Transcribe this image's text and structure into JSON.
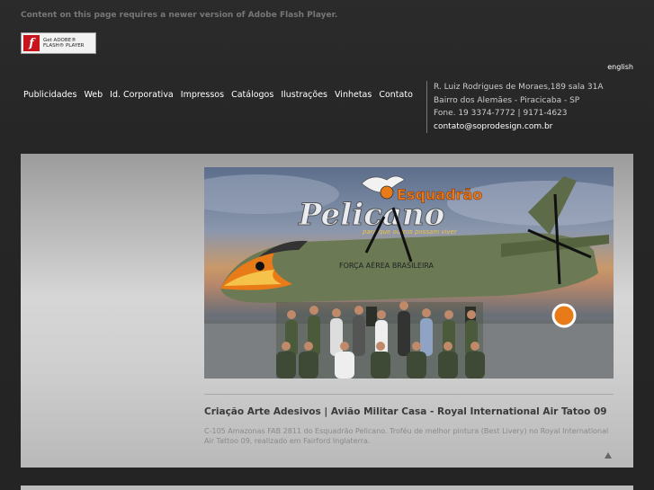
{
  "flash": {
    "message": "Content on this page requires a newer version of Adobe Flash Player.",
    "badge_top": "Get ADOBE®",
    "badge_bottom": "FLASH® PLAYER",
    "icon_letter": "f"
  },
  "lang_link": "english",
  "menu": {
    "items": [
      {
        "label": "Publicidades"
      },
      {
        "label": "Web"
      },
      {
        "label": "Id. Corporativa"
      },
      {
        "label": "Impressos"
      },
      {
        "label": "Catálogos"
      },
      {
        "label": "Ilustrações"
      },
      {
        "label": "Vinhetas"
      },
      {
        "label": "Contato"
      }
    ]
  },
  "address": {
    "line1": "R. Luiz Rodrigues de Moraes,189 sala 31A",
    "line2": "Bairro dos Alemães - Piracicaba - SP",
    "line3": "Fone. 19 3374-7772 | 9171-4623",
    "email": "contato@soprodesign.com.br"
  },
  "featured": {
    "logo_top": "Esquadrão",
    "logo_main": "Pelicano",
    "logo_sub": "para que outros possam viver",
    "plane_text": "FORÇA AÉREA BRASILEIRA",
    "title": "Criação Arte Adesivos | Avião Militar Casa - Royal International Air Tatoo 09",
    "description": "C-105 Amazonas FAB 2811 do Esquadrão Pelicano. Troféu de melhor pintura (Best Livery) no Royal International Air Tattoo 09, realizado em Fairford Inglaterra."
  },
  "colors": {
    "background": "#262626",
    "flash_red": "#c8141b",
    "panel": "#d0d0d0",
    "caption_title": "#3a3a3a",
    "plane_body": "#6b7a55",
    "beak_orange": "#e87a18"
  }
}
